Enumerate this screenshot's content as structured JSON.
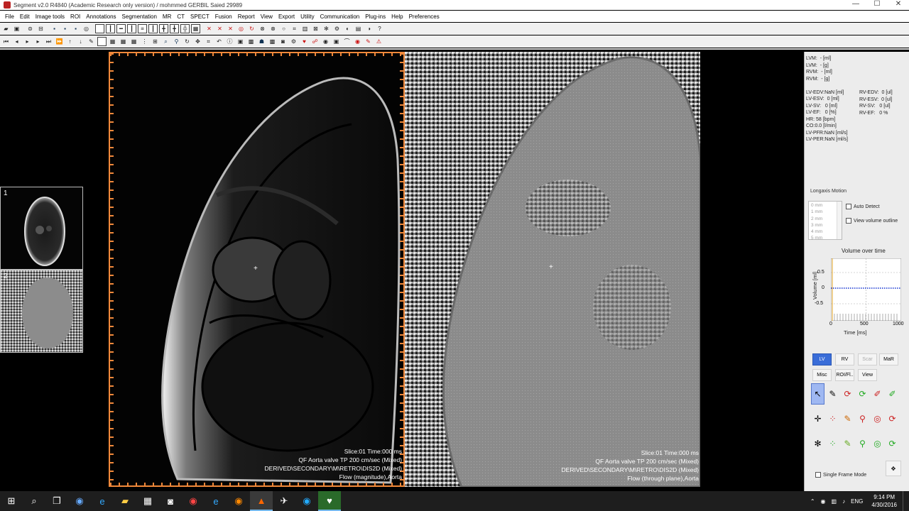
{
  "window": {
    "title": "Segment v2.0 R4840 (Academic Research only version) / mohmmed GERBIL Saied 29989",
    "controls": [
      "—",
      "☐",
      "✕"
    ]
  },
  "menu": [
    "File",
    "Edit",
    "Image tools",
    "ROI",
    "Annotations",
    "Segmentation",
    "MR",
    "CT",
    "SPECT",
    "Fusion",
    "Report",
    "View",
    "Export",
    "Utility",
    "Communication",
    "Plug-ins",
    "Help",
    "Preferences"
  ],
  "thumbnails": [
    {
      "number": "1"
    },
    {
      "number": "2"
    }
  ],
  "views": {
    "left": {
      "lines": [
        "Slice:01 Time:000 ms",
        "QF Aorta valve TP 200 cm/sec (Mixed)",
        "DERIVED\\SECONDARY\\M\\RETRO\\DIS2D  (Mixed)",
        "Flow (magnitude),Aorta"
      ]
    },
    "right": {
      "lines": [
        "Slice:01 Time:000 ms",
        "QF Aorta valve TP 200 cm/sec (Mixed)",
        "DERIVED\\SECONDARY\\M\\RETRO\\DIS2D  (Mixed)",
        "Flow (through plane),Aorta"
      ]
    }
  },
  "panel": {
    "stats_left": "LVM:  - [ml]\nLVM:  - [g]\nRVM:  - [ml]\nRVM:  - [g]\n\nLV-EDV:NaN [ml]\nLV-ESV:  0 [ml]\nLV-SV:   0 [ml]\nLV-EF:   0 [%]\nHR: 58 [bpm]\nCO:0.0 [l/min]\nLV-PFR:NaN [ml/s]\nLV-PER:NaN [ml/s]",
    "stats_right": "RV-EDV:  0 [ul]\nRV-ESV:  0 [ul]\nRV-SV:   0 [ul]\nRV-EF:   0 %",
    "longaxis_label": "Longaxis Motion",
    "longaxis_items": [
      "0 mm",
      "1 mm",
      "2 mm",
      "3 mm",
      "4 mm",
      "5 mm"
    ],
    "auto_detect": "Auto Detect",
    "view_volume_outline": "View volume outline",
    "volume_title": "Volume over time",
    "volume_ylabel": "Volume [ml]",
    "volume_xlabel": "Time [ms]",
    "volume_yticks": [
      "0.5",
      "0",
      "-0.5"
    ],
    "volume_xticks": [
      "0",
      "500",
      "1000"
    ],
    "tabs_row1": [
      "LV",
      "RV",
      "Scar",
      "MaR"
    ],
    "tabs_row2": [
      "Misc",
      "ROI/Fl..",
      "View"
    ],
    "single_frame_mode": "Single Frame Mode"
  },
  "taskbar": {
    "time": "9:14 PM",
    "date": "4/30/2016",
    "lang": "ENG"
  }
}
